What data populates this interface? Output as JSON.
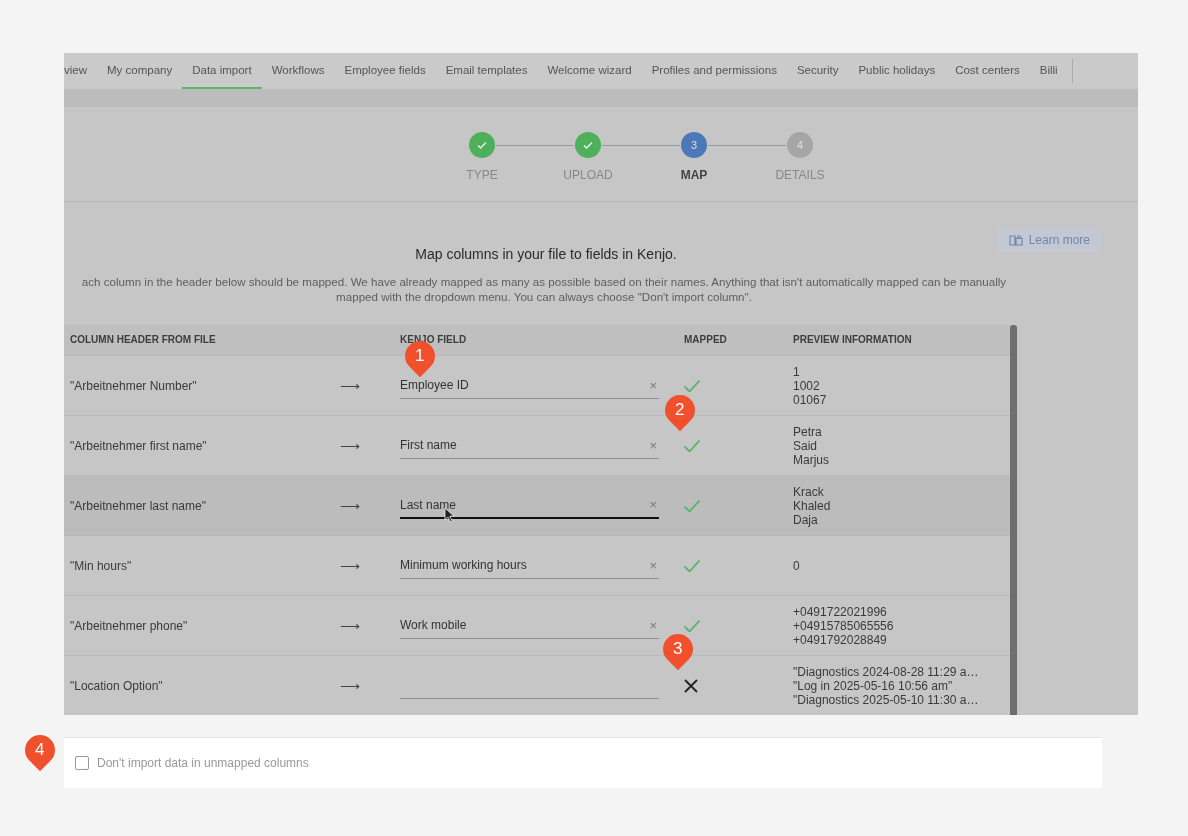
{
  "tabs": [
    {
      "label": "view",
      "selected": false
    },
    {
      "label": "My company",
      "selected": false
    },
    {
      "label": "Data import",
      "selected": true
    },
    {
      "label": "Workflows",
      "selected": false
    },
    {
      "label": "Employee fields",
      "selected": false
    },
    {
      "label": "Email templates",
      "selected": false
    },
    {
      "label": "Welcome wizard",
      "selected": false
    },
    {
      "label": "Profiles and permissions",
      "selected": false
    },
    {
      "label": "Security",
      "selected": false
    },
    {
      "label": "Public holidays",
      "selected": false
    },
    {
      "label": "Cost centers",
      "selected": false
    },
    {
      "label": "Billi",
      "selected": false
    }
  ],
  "steps": [
    {
      "label": "TYPE",
      "done": true,
      "selected": false
    },
    {
      "label": "UPLOAD",
      "done": true,
      "selected": false
    },
    {
      "label": "MAP",
      "done": false,
      "selected": true,
      "number": "3"
    },
    {
      "label": "DETAILS",
      "done": false,
      "selected": false,
      "number": "4"
    }
  ],
  "learn_more": "Learn more",
  "heading": "Map columns in your file to fields in Kenjo.",
  "intro": "ach column in the header below should be mapped. We have already mapped as many as possible based on their names. Anything that isn't automatically mapped can be manually mapped with the dropdown menu. You can always choose \"Don't import column\".",
  "table": {
    "columns": [
      "COLUMN HEADER FROM FILE",
      "KENJO FIELD",
      "MAPPED",
      "PREVIEW INFORMATION"
    ],
    "rows": [
      {
        "header": "\"Arbeitnehmer Number\"",
        "arrow": "⟶",
        "field": "Employee ID",
        "clear": "×",
        "mapped": true,
        "hovered": false,
        "preview": [
          "1",
          "1002",
          "01067"
        ]
      },
      {
        "header": "\"Arbeitnehmer first name\"",
        "arrow": "⟶",
        "field": "First name",
        "clear": "×",
        "mapped": true,
        "hovered": false,
        "preview": [
          "Petra",
          "Said",
          "Marjus"
        ]
      },
      {
        "header": "\"Arbeitnehmer last name\"",
        "arrow": "⟶",
        "field": "Last name",
        "clear": "×",
        "mapped": true,
        "hovered": true,
        "preview": [
          "Krack",
          "Khaled",
          "Daja"
        ]
      },
      {
        "header": "\"Min hours\"",
        "arrow": "⟶",
        "field": "Minimum working hours",
        "clear": "×",
        "mapped": true,
        "hovered": false,
        "preview": [
          "0"
        ]
      },
      {
        "header": "\"Arbeitnehmer phone\"",
        "arrow": "⟶",
        "field": "Work mobile",
        "clear": "×",
        "mapped": true,
        "hovered": false,
        "preview": [
          "+0491722021996",
          "+04915785065556",
          "+0491792028849"
        ]
      },
      {
        "header": "\"Location Option\"",
        "arrow": "⟶",
        "mapped": false,
        "hovered": false,
        "preview": [
          "\"Diagnostics 2024-08-28 11:29 a…",
          "\"Log in 2025-05-16 10:56 am\"",
          "\"Diagnostics 2025-05-10 11:30 a…"
        ]
      }
    ]
  },
  "option": {
    "label": "Don't import data in unmapped columns",
    "checked": false
  },
  "pins": [
    "1",
    "2",
    "3",
    "4"
  ]
}
